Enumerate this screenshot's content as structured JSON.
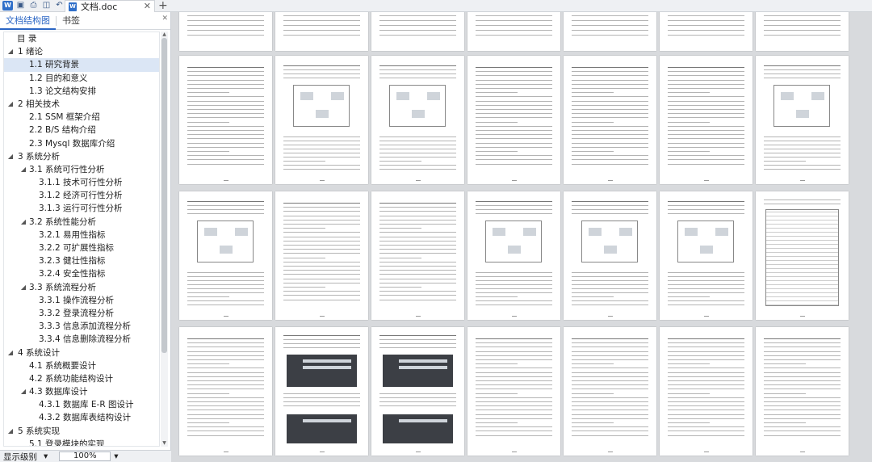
{
  "tab": {
    "title": "文档.doc",
    "close_glyph": "✕",
    "add_glyph": "+"
  },
  "nav": {
    "tab_outline": "文档结构图",
    "tab_bookmark": "书签",
    "close_glyph": "✕",
    "items": [
      {
        "label": "目  录",
        "level": 0,
        "toggle": ""
      },
      {
        "label": "1  绪论",
        "level": 1,
        "toggle": "◢"
      },
      {
        "label": "1.1  研究背景",
        "level": "A",
        "toggle": "",
        "selected": true
      },
      {
        "label": "1.2  目的和意义",
        "level": "A",
        "toggle": ""
      },
      {
        "label": "1.3  论文结构安排",
        "level": "A",
        "toggle": ""
      },
      {
        "label": "2  相关技术",
        "level": 1,
        "toggle": "◢"
      },
      {
        "label": "2.1  SSM 框架介绍",
        "level": "A",
        "toggle": ""
      },
      {
        "label": "2.2  B/S 结构介绍",
        "level": "A",
        "toggle": ""
      },
      {
        "label": "2.3  Mysql 数据库介绍",
        "level": "A",
        "toggle": ""
      },
      {
        "label": "3  系统分析",
        "level": 1,
        "toggle": "◢"
      },
      {
        "label": "3.1  系统可行性分析",
        "level": 2,
        "toggle": "◢"
      },
      {
        "label": "3.1.1  技术可行性分析",
        "level": 3,
        "toggle": ""
      },
      {
        "label": "3.1.2  经济可行性分析",
        "level": 3,
        "toggle": ""
      },
      {
        "label": "3.1.3  运行可行性分析",
        "level": 3,
        "toggle": ""
      },
      {
        "label": "3.2  系统性能分析",
        "level": 2,
        "toggle": "◢"
      },
      {
        "label": "3.2.1  易用性指标",
        "level": 3,
        "toggle": ""
      },
      {
        "label": "3.2.2  可扩展性指标",
        "level": 3,
        "toggle": ""
      },
      {
        "label": "3.2.3  健壮性指标",
        "level": 3,
        "toggle": ""
      },
      {
        "label": "3.2.4  安全性指标",
        "level": 3,
        "toggle": ""
      },
      {
        "label": "3.3  系统流程分析",
        "level": 2,
        "toggle": "◢"
      },
      {
        "label": "3.3.1  操作流程分析",
        "level": 3,
        "toggle": ""
      },
      {
        "label": "3.3.2  登录流程分析",
        "level": 3,
        "toggle": ""
      },
      {
        "label": "3.3.3  信息添加流程分析",
        "level": 3,
        "toggle": ""
      },
      {
        "label": "3.3.4  信息删除流程分析",
        "level": 3,
        "toggle": ""
      },
      {
        "label": "4  系统设计",
        "level": 1,
        "toggle": "◢"
      },
      {
        "label": "4.1  系统概要设计",
        "level": "A",
        "toggle": ""
      },
      {
        "label": "4.2  系统功能结构设计",
        "level": "A",
        "toggle": ""
      },
      {
        "label": "4.3  数据库设计",
        "level": 2,
        "toggle": "◢"
      },
      {
        "label": "4.3.1  数据库 E-R 图设计",
        "level": 3,
        "toggle": ""
      },
      {
        "label": "4.3.2  数据库表结构设计",
        "level": 3,
        "toggle": ""
      },
      {
        "label": "5  系统实现",
        "level": 1,
        "toggle": "◢"
      },
      {
        "label": "5.1  登录模块的实现",
        "level": "A",
        "toggle": ""
      }
    ]
  },
  "status": {
    "outline_level": "显示级别",
    "zoom": "100%"
  },
  "icons": [
    "save-icon",
    "print-icon",
    "preview-icon",
    "undo-icon",
    "redo-icon",
    "more-icon",
    "doc-icon"
  ]
}
